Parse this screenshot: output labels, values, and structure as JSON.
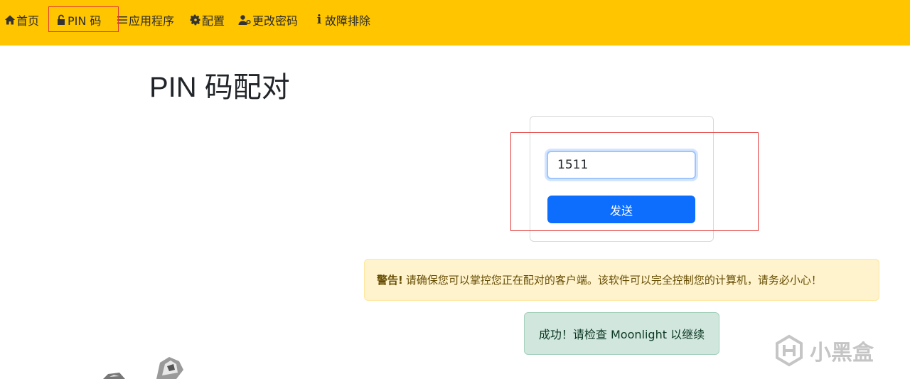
{
  "nav": {
    "home": {
      "label": "首页",
      "icon": "home-icon"
    },
    "pin": {
      "label": "PIN 码",
      "icon": "unlock-icon"
    },
    "apps": {
      "label": "应用程序",
      "icon": "list-icon"
    },
    "config": {
      "label": "配置",
      "icon": "gear-icon"
    },
    "password": {
      "label": "更改密码",
      "icon": "user-key-icon"
    },
    "troubleshoot": {
      "label": "故障排除",
      "icon": "info-icon"
    }
  },
  "page": {
    "title": "PIN 码配对"
  },
  "form": {
    "pin_value": "1511",
    "send_label": "发送"
  },
  "alerts": {
    "warning_strong": "警告!",
    "warning_text": "请确保您可以掌控您正在配对的客户端。该软件可以完全控制您的计算机，请务必小心！",
    "success_text": "成功！请检查 Moonlight 以继续"
  },
  "watermark": {
    "text": "小黑盒"
  },
  "colors": {
    "navbar": "#ffc600",
    "primary": "#0d6efd",
    "warning_bg": "#fff3cd",
    "success_bg": "#d1e7dd",
    "highlight": "#e23b3b"
  }
}
